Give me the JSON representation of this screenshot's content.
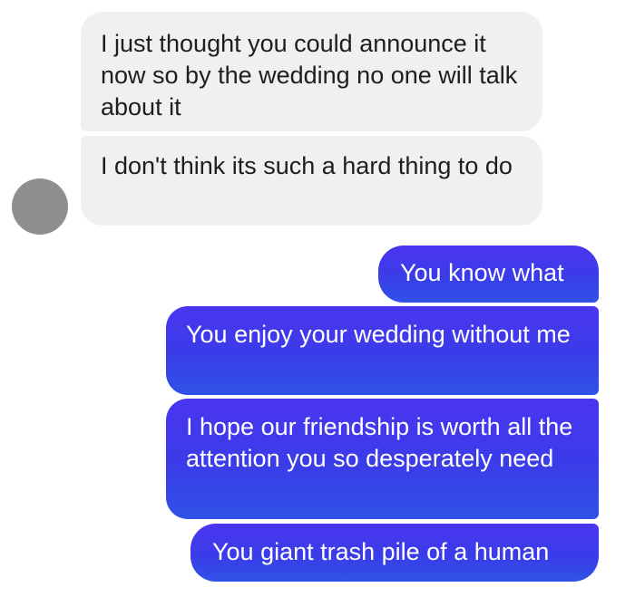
{
  "conversation": {
    "incoming": [
      {
        "text": "I just thought you could announce it now so by the wedding no one will talk about it"
      },
      {
        "text": "I don't think its such a hard thing to do"
      }
    ],
    "outgoing": [
      {
        "text": "You know what"
      },
      {
        "text": "You enjoy your wedding without me"
      },
      {
        "text": "I hope our friendship is worth all the attention you so desperately need"
      },
      {
        "text": "You giant trash pile of a human"
      }
    ]
  },
  "colors": {
    "incoming_bubble": "#f1f0f0",
    "outgoing_bubble": "#3a3ce8",
    "avatar": "#8f8f8f"
  }
}
